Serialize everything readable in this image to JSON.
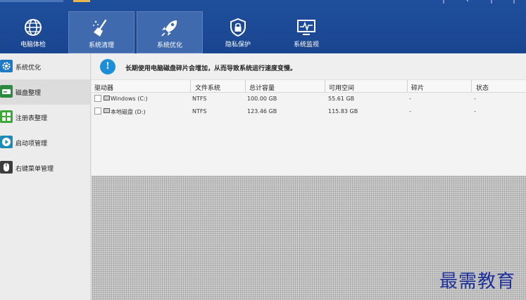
{
  "tabs": [
    {
      "label": "电脑体检",
      "icon": "globe-scan-icon"
    },
    {
      "label": "系统清理",
      "icon": "broom-icon"
    },
    {
      "label": "系统优化",
      "icon": "rocket-icon"
    },
    {
      "label": "隐私保护",
      "icon": "shield-lock-icon"
    },
    {
      "label": "系统监视",
      "icon": "monitor-pulse-icon"
    }
  ],
  "sidebar": {
    "items": [
      {
        "label": "系统优化",
        "icon": "gear-icon"
      },
      {
        "label": "磁盘整理",
        "icon": "disk-icon"
      },
      {
        "label": "注册表整理",
        "icon": "registry-grid-icon"
      },
      {
        "label": "启动项管理",
        "icon": "play-circle-icon"
      },
      {
        "label": "右键菜单管理",
        "icon": "mouse-icon"
      }
    ]
  },
  "notice": {
    "message": "长期使用电脑磁盘碎片会增加，从而导致系统运行速度变慢。"
  },
  "table": {
    "headers": [
      "驱动器",
      "文件系统",
      "总计容量",
      "可用空间",
      "碎片",
      "状态"
    ],
    "rows": [
      {
        "drive": "Windows (C:)",
        "fs": "NTFS",
        "total": "100.00 GB",
        "free": "55.61 GB",
        "frag": "-",
        "status": "-"
      },
      {
        "drive": "本地磁盘 (D:)",
        "fs": "NTFS",
        "total": "123.46 GB",
        "free": "115.83 GB",
        "frag": "-",
        "status": "-"
      }
    ]
  },
  "watermark": "最需教育",
  "colors": {
    "topbar": "#1f4f9c",
    "tab_highlight": "#3f6aad",
    "info_icon": "#1d8ed8",
    "watermark": "#1c2f9a"
  }
}
